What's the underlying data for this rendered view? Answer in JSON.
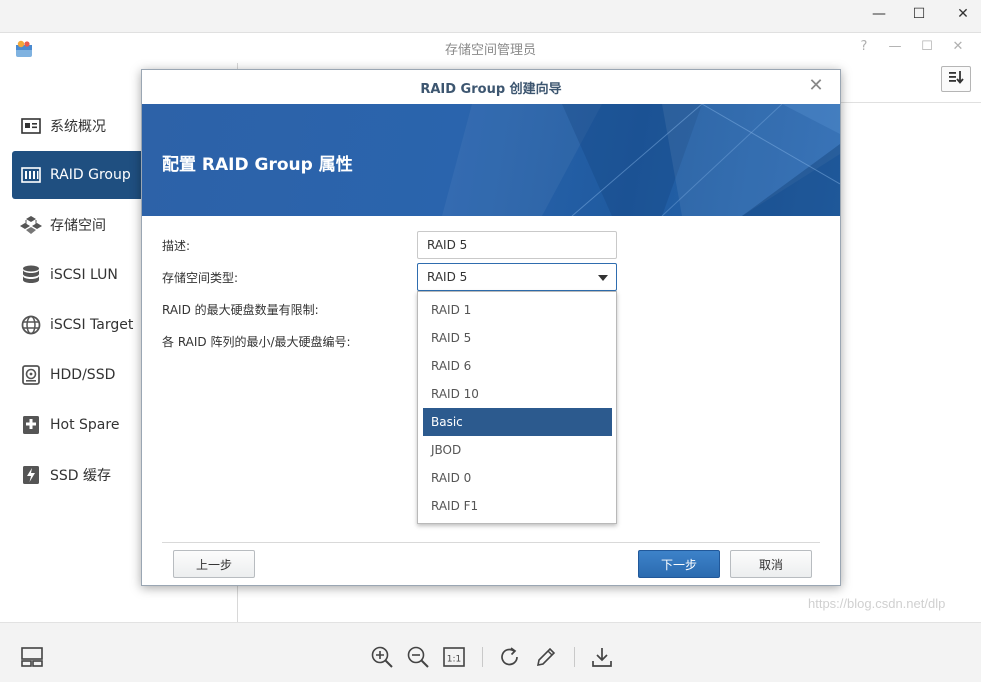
{
  "os_window": {
    "minimize_glyph": "—",
    "maximize_glyph": "☐",
    "close_glyph": "✕"
  },
  "app": {
    "title": "存储空间管理员",
    "help_glyph": "?",
    "min_glyph": "—",
    "max_glyph": "☐",
    "close_glyph": "✕"
  },
  "sidebar": {
    "items": [
      {
        "label": "系统概况",
        "icon": "overview-icon"
      },
      {
        "label": "RAID Group",
        "icon": "raid-group-icon",
        "active": true
      },
      {
        "label": "存储空间",
        "icon": "cubes-icon"
      },
      {
        "label": "iSCSI LUN",
        "icon": "database-icon"
      },
      {
        "label": "iSCSI Target",
        "icon": "globe-icon"
      },
      {
        "label": "HDD/SSD",
        "icon": "hdd-icon"
      },
      {
        "label": "Hot Spare",
        "icon": "hot-spare-icon"
      },
      {
        "label": "SSD 缓存",
        "icon": "ssd-cache-icon"
      }
    ]
  },
  "dialog": {
    "title": "RAID Group 创建向导",
    "heading": "配置 RAID Group 属性",
    "fields": {
      "description_label": "描述:",
      "description_value": "RAID 5",
      "storage_type_label": "存储空间类型:",
      "storage_type_value": "RAID 5",
      "max_disk_limit_label": "RAID 的最大硬盘数量有限制:",
      "min_max_disk_label": "各 RAID 阵列的最小/最大硬盘编号:"
    },
    "dropdown_options": [
      "RAID 1",
      "RAID 5",
      "RAID 6",
      "RAID 10",
      "Basic",
      "JBOD",
      "RAID 0",
      "RAID F1"
    ],
    "dropdown_highlighted": "Basic",
    "buttons": {
      "back": "上一步",
      "next": "下一步",
      "cancel": "取消"
    }
  },
  "watermark": "https://blog.csdn.net/dlp",
  "colors": {
    "accent": "#2b6bb0",
    "sidebar_active": "#1f4f80",
    "banner": "#2a64ad",
    "highlight": "#2c5a8e"
  }
}
